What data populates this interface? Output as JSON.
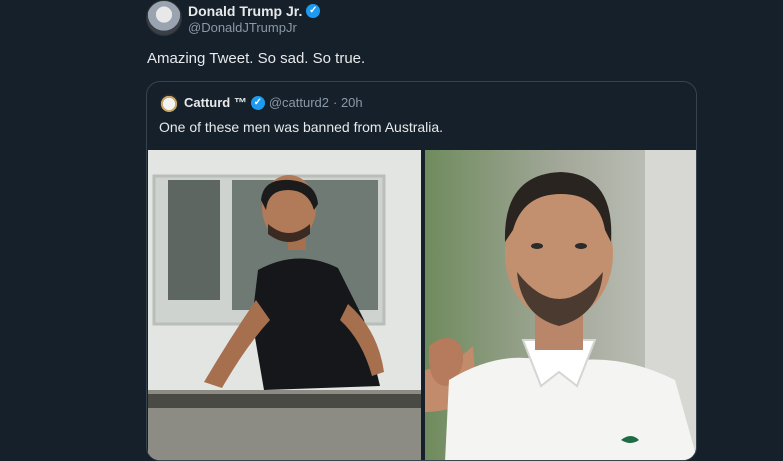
{
  "tweet": {
    "author_name": "Donald Trump Jr.",
    "author_handle": "@DonaldJTrumpJr",
    "verified_icon": "verified-badge-icon",
    "text": "Amazing Tweet. So sad. So true."
  },
  "quoted_tweet": {
    "author_name": "Catturd ™",
    "author_handle": "@catturd2",
    "time": "· 20h",
    "text": "One of these men was banned from Australia.",
    "images": [
      "photo-man-on-rooftop",
      "photo-tennis-player"
    ]
  },
  "colors": {
    "background": "#15202b",
    "text": "#e7e9ea",
    "secondary_text": "#8b98a5",
    "verified_blue": "#1d9bf0"
  }
}
